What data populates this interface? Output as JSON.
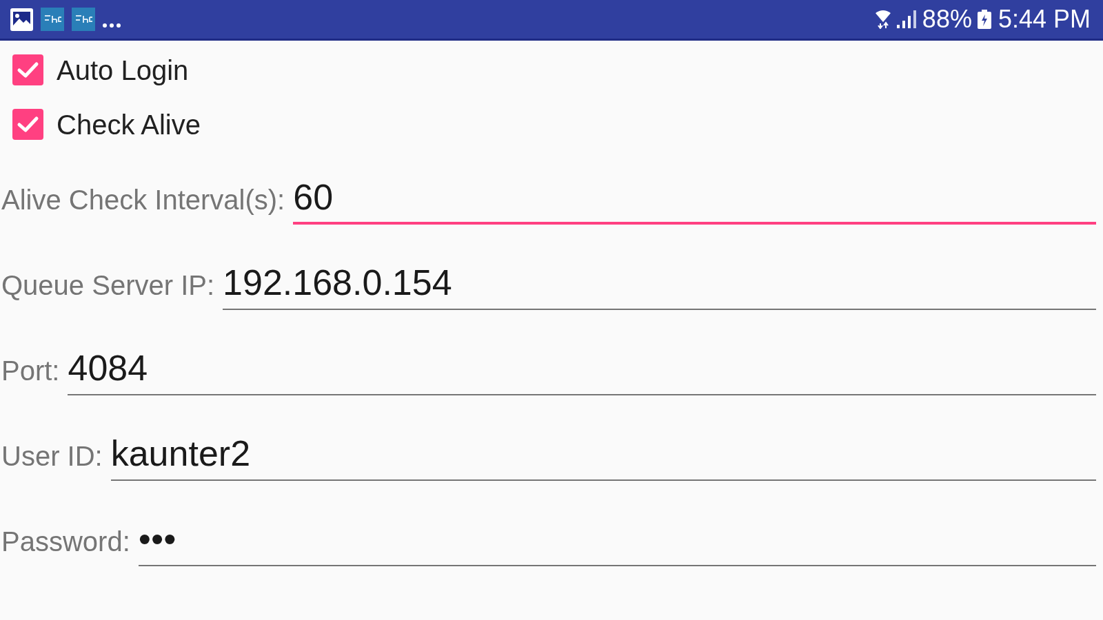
{
  "status_bar": {
    "battery": "88%",
    "time": "5:44 PM"
  },
  "checkboxes": [
    {
      "label": "Auto Login",
      "checked": true
    },
    {
      "label": "Check Alive",
      "checked": true
    }
  ],
  "fields": [
    {
      "label": "Alive Check Interval(s):",
      "value": "60",
      "focused": true
    },
    {
      "label": "Queue Server IP:",
      "value": "192.168.0.154",
      "focused": false
    },
    {
      "label": "Port:",
      "value": "4084",
      "focused": false
    },
    {
      "label": "User ID:",
      "value": "kaunter2",
      "focused": false
    },
    {
      "label": "Password:",
      "value": "•••",
      "focused": false
    }
  ]
}
